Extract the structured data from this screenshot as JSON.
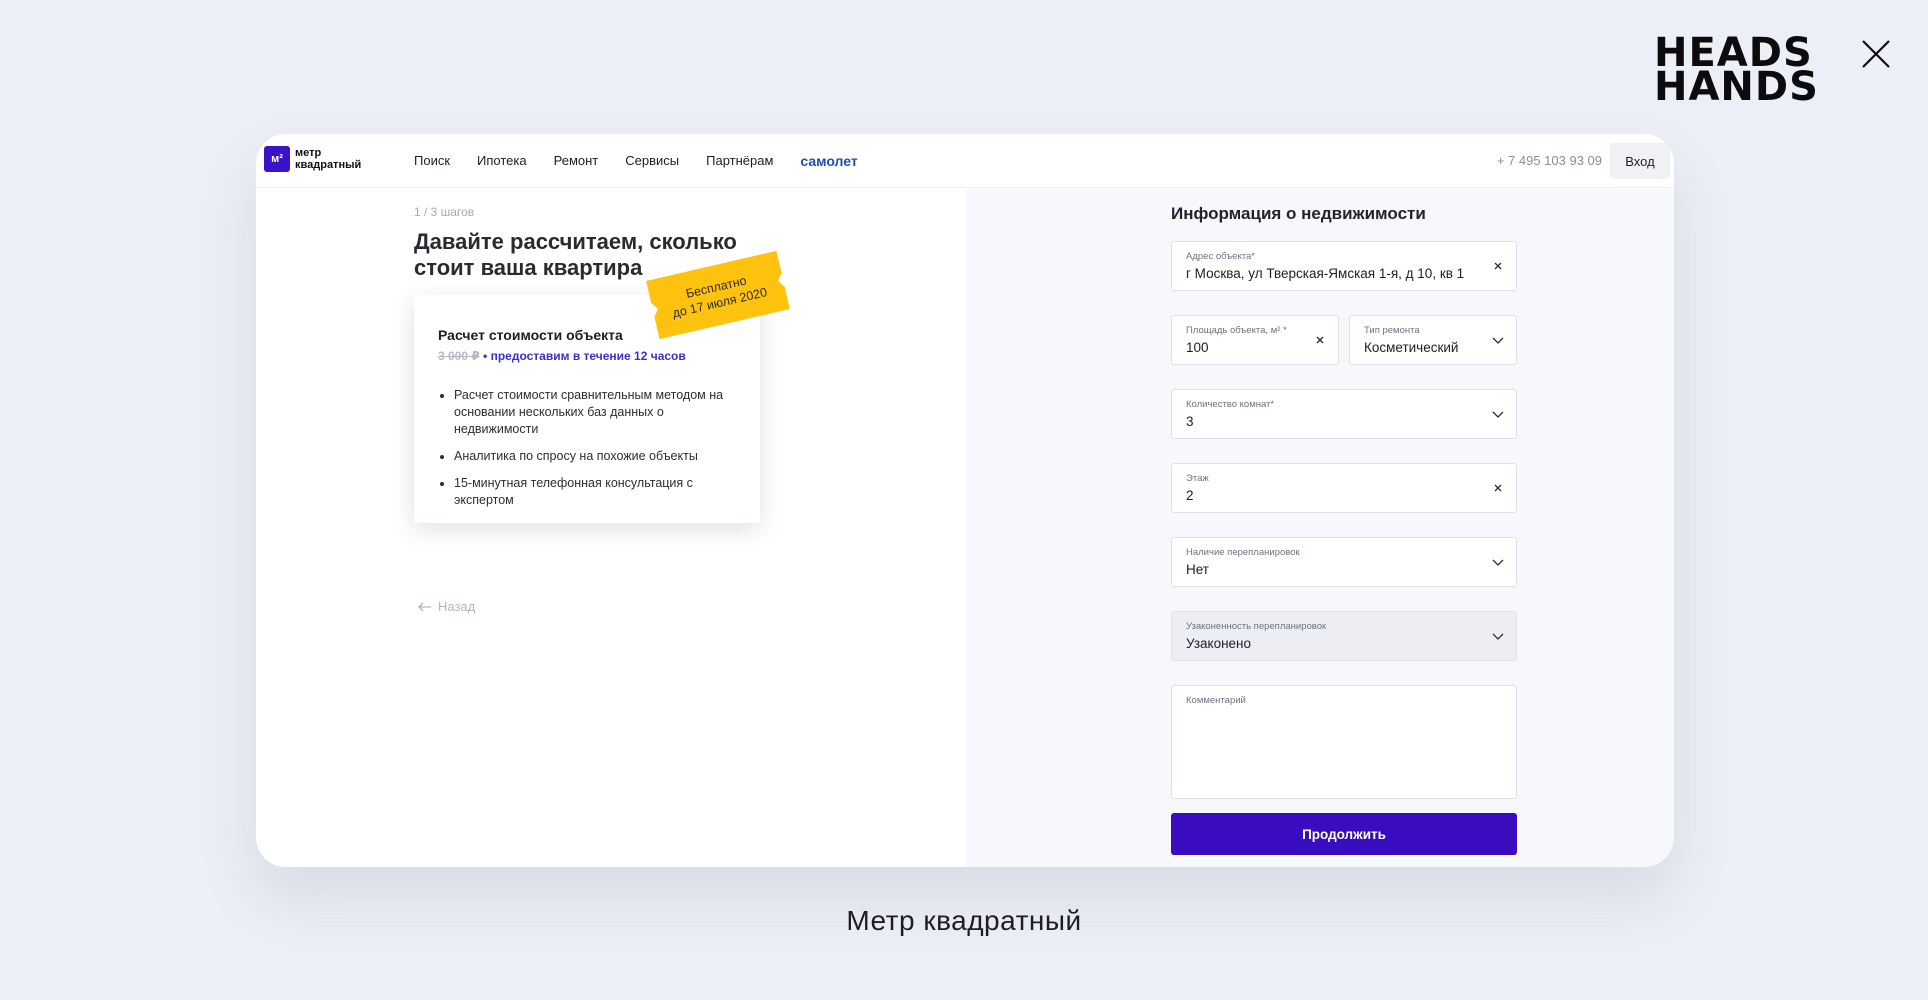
{
  "brand": {
    "line1": "HEADS",
    "line2": "HANDS"
  },
  "caption": "Метр квадратный",
  "header": {
    "logo_line1": "метр",
    "logo_line2": "квадратный",
    "logo_mark": "м²",
    "nav": [
      "Поиск",
      "Ипотека",
      "Ремонт",
      "Сервисы",
      "Партнёрам",
      "самолет"
    ],
    "phone": "+ 7 495 103 93 09",
    "login": "Вход"
  },
  "left": {
    "step": "1 / 3 шагов",
    "headline": "Давайте рассчитаем, сколько стоит ваша квартира",
    "card": {
      "title": "Расчет стоимости объекта",
      "old_price": "3 000 ₽",
      "price_note": " • предоставим в течение 12 часов",
      "items": [
        "Расчет стоимости сравнительным методом на основании нескольких баз данных о недвижимости",
        "Аналитика по спросу на похожие объекты",
        "15-минутная телефонная консультация с экспертом"
      ],
      "ticket_line1": "Бесплатно",
      "ticket_line2": "до 17 июля 2020"
    },
    "back": "Назад"
  },
  "form": {
    "title": "Информация о недвижимости",
    "address": {
      "label": "Адрес объекта*",
      "value": "г Москва, ул Тверская-Ямская 1-я, д 10, кв 1"
    },
    "area": {
      "label": "Площадь объекта, м² *",
      "value": "100"
    },
    "repair": {
      "label": "Тип ремонта",
      "value": "Косметический"
    },
    "rooms": {
      "label": "Количество комнат*",
      "value": "3"
    },
    "floor": {
      "label": "Этаж",
      "value": "2"
    },
    "replan": {
      "label": "Наличие перепланировок",
      "value": "Нет"
    },
    "legal": {
      "label": "Узаконенность перепланировок",
      "value": "Узаконено"
    },
    "comment": {
      "label": "Комментарий",
      "value": ""
    },
    "submit": "Продолжить"
  }
}
